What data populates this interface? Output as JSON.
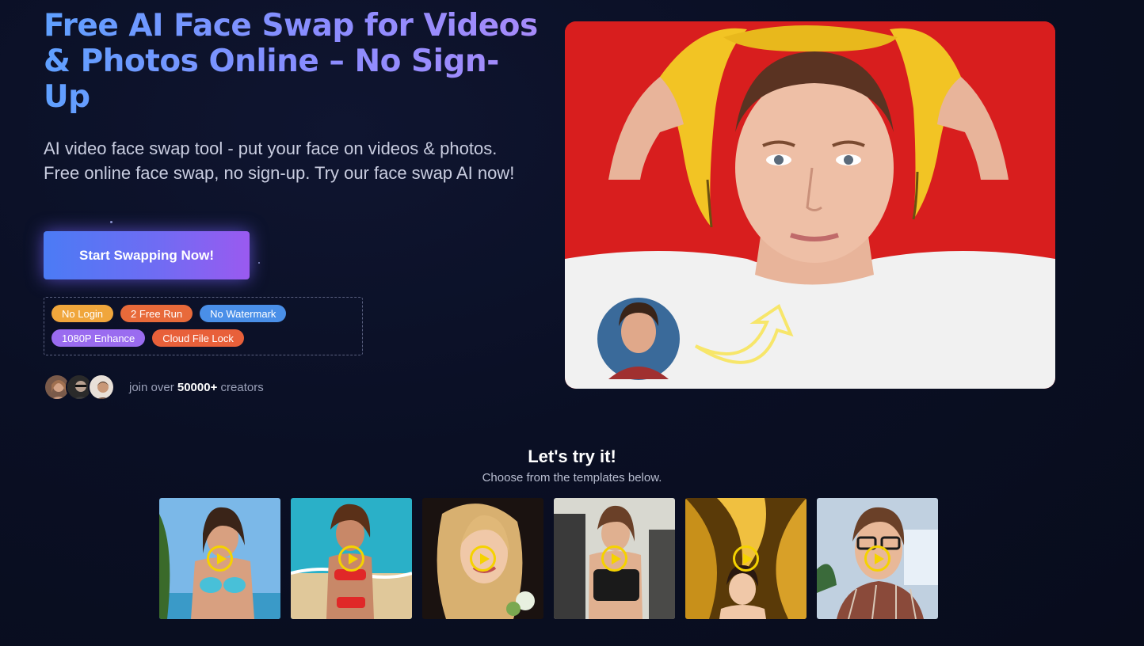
{
  "hero": {
    "title": "Free AI Face Swap for Videos & Photos Online – No Sign-Up",
    "subtitle": "AI video face swap tool - put your face on videos & photos. Free online face swap, no sign-up. Try our face swap AI now!",
    "cta_label": "Start Swapping Now!",
    "badges": [
      {
        "label": "No Login",
        "color": "#f0a63c"
      },
      {
        "label": "2 Free Run",
        "color": "#e86a3a"
      },
      {
        "label": "No Watermark",
        "color": "#4a8fe8"
      },
      {
        "label": "1080P Enhance",
        "color": "#9a6cf0"
      },
      {
        "label": "Cloud File Lock",
        "color": "#e8603a"
      }
    ],
    "creators": {
      "prefix": "join over",
      "count": "50000+",
      "suffix": "creators"
    }
  },
  "templates_section": {
    "title": "Let's try it!",
    "subtitle": "Choose from the templates below."
  },
  "colors": {
    "accent_start": "#4b7bf5",
    "accent_end": "#9a5af0",
    "play": "#f5d200",
    "background": "#0a0f24"
  }
}
